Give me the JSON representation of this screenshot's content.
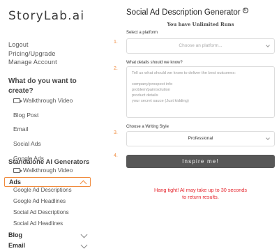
{
  "sidebar": {
    "logo": "StoryLab.ai",
    "account": [
      "Logout",
      "Pricing/Upgrade",
      "Manage Account"
    ],
    "what_heading": "What do you want to create?",
    "what_items": [
      "Walkthrough Video",
      "Blog Post",
      "Email",
      "Social Ads",
      "Google Ads"
    ],
    "standalone_heading": "Standalone AI Generators",
    "standalone_video": "Walkthrough Video",
    "categories": {
      "ads": "Ads",
      "blog": "Blog",
      "email": "Email"
    },
    "ads_items": [
      "Google Ad Descriptions",
      "Google Ad Headlines",
      "Social Ad Descriptions",
      "Social Ad Headlines"
    ]
  },
  "main": {
    "title": "Social Ad Description Generator",
    "info_symbol": "0",
    "unlimited": "You have Unlimited Runs",
    "platform_label": "Select a platform",
    "platform_placeholder": "Choose an platform...",
    "details_label": "What details should we know?",
    "details_placeholder_lines": [
      "Tell us what should we know to deliver the best outcomes:",
      "",
      "company/prospect info",
      "problem/pain/solution",
      "product details",
      "your secret sauce (Just kidding)"
    ],
    "style_label": "Choose a Writing Style",
    "style_value": "Professional",
    "steps": [
      "1.",
      "2.",
      "3.",
      "4."
    ],
    "button_label": "Inspire me!",
    "hang_line1": "Hang tight! AI may take up to 30 seconds",
    "hang_line2": "to return results."
  },
  "colors": {
    "accent": "#f08a3c",
    "warning_text": "#e5232b",
    "button_bg": "#575757"
  }
}
